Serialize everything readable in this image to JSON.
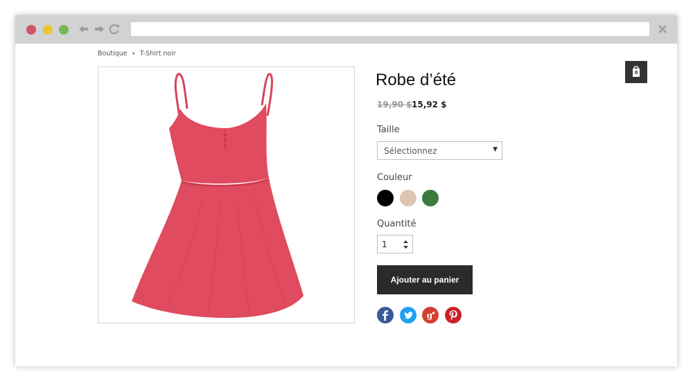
{
  "breadcrumb": {
    "items": [
      "Boutique",
      "T-Shirt noir"
    ],
    "separator": "›"
  },
  "cart": {
    "count": "0",
    "icon": "shopping-bag-icon"
  },
  "product": {
    "title": "Robe d’été",
    "old_price": "19,90 $",
    "price": "15,92 $",
    "image_color": "#e04b5f"
  },
  "options": {
    "size_label": "Taille",
    "size_value": "Sélectionnez",
    "color_label": "Couleur",
    "colors": [
      "#000000",
      "#dcc5b3",
      "#3a7a3f"
    ],
    "quantity_label": "Quantité",
    "quantity_value": "1"
  },
  "actions": {
    "add_to_cart": "Ajouter au panier"
  },
  "social": [
    {
      "name": "facebook-icon",
      "color": "#3b5998"
    },
    {
      "name": "twitter-icon",
      "color": "#1da1f2"
    },
    {
      "name": "google-plus-icon",
      "color": "#d23f31"
    },
    {
      "name": "pinterest-icon",
      "color": "#cb2027"
    }
  ]
}
